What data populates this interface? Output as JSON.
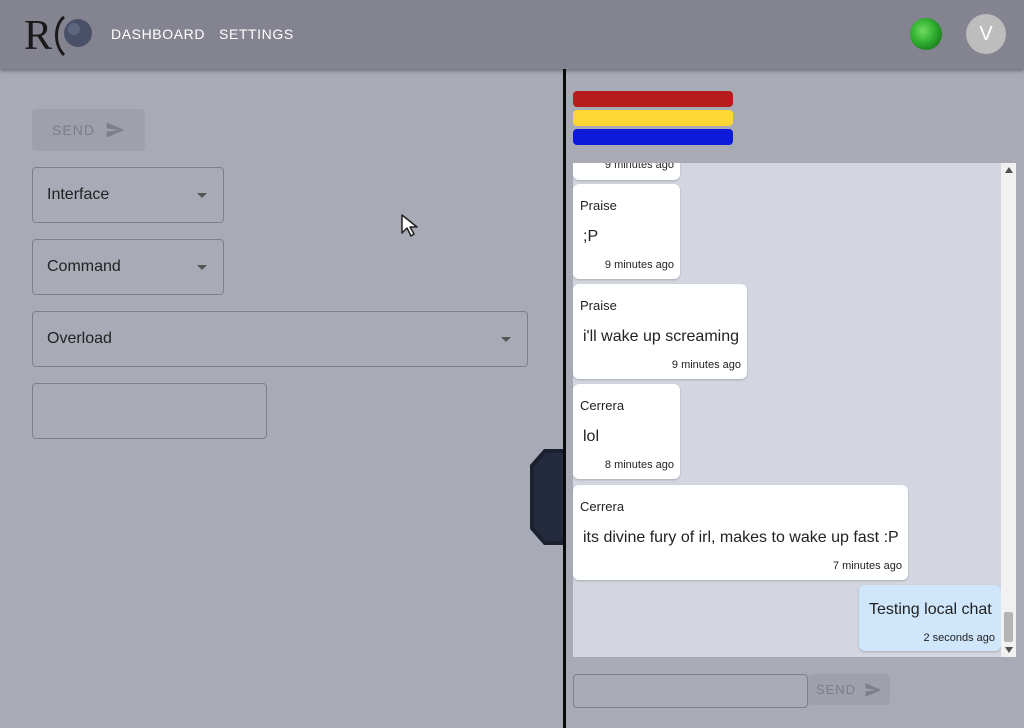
{
  "header": {
    "logo_alt": "R",
    "nav": [
      {
        "label": "DASHBOARD"
      },
      {
        "label": "SETTINGS"
      }
    ],
    "avatar_initial": "V",
    "status_color": "#2fae2f"
  },
  "controls": {
    "send_label": "SEND",
    "interface": {
      "value": "Interface"
    },
    "command": {
      "value": "Command"
    },
    "overload": {
      "value": "Overload"
    },
    "text_input": {
      "value": ""
    }
  },
  "flag_colors": [
    "#b71c1c",
    "#fdd835",
    "#0d1ad9"
  ],
  "chat": {
    "top_partial_time": "9 minutes ago",
    "messages": [
      {
        "author": "Praise",
        "text": ";P",
        "time": "9 minutes ago",
        "own": false
      },
      {
        "author": "Praise",
        "text": "i'll wake up screaming",
        "time": "9 minutes ago",
        "own": false
      },
      {
        "author": "Cerrera",
        "text": "lol",
        "time": "8 minutes ago",
        "own": false
      },
      {
        "author": "Cerrera",
        "text": "its divine fury of irl, makes to wake up fast :P",
        "time": "7 minutes ago",
        "own": false
      },
      {
        "author": "",
        "text": "Testing local chat",
        "time": "2 seconds ago",
        "own": true
      }
    ],
    "input": {
      "value": ""
    },
    "send_label": "SEND"
  }
}
